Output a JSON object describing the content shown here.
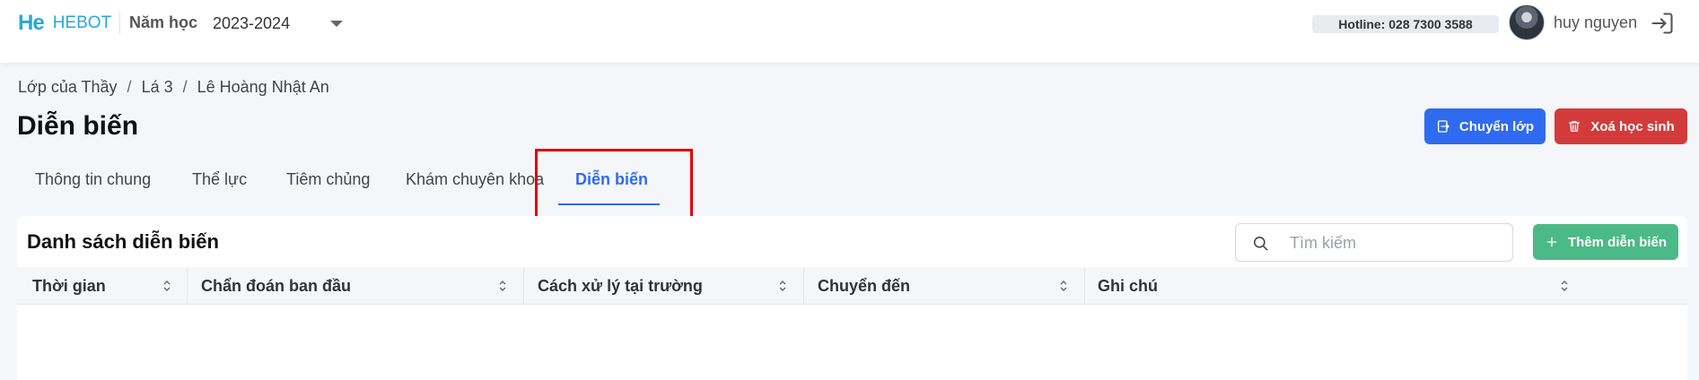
{
  "header": {
    "logo_mark": "He",
    "brand": "HEBOT",
    "year_label": "Năm học",
    "year_value": "2023-2024",
    "hotline": "Hotline: 028 7300 3588",
    "user_name": "huy nguyen"
  },
  "breadcrumb": {
    "items": [
      "Lớp của Thầy",
      "Lá 3",
      "Lê Hoàng Nhật An"
    ],
    "separator": "/"
  },
  "page": {
    "title": "Diễn biến",
    "move_button": "Chuyển lớp",
    "delete_button": "Xoá học sinh"
  },
  "tabs": [
    "Thông tin chung",
    "Thể lực",
    "Tiêm chủng",
    "Khám chuyên khoa",
    "Diễn biến"
  ],
  "active_tab": "Diễn biến",
  "list": {
    "title": "Danh sách diễn biến",
    "search_placeholder": "Tìm kiếm",
    "add_button": "Thêm diễn biến",
    "columns": [
      "Thời gian",
      "Chẩn đoán ban đầu",
      "Cách xử lý tại trường",
      "Chuyển đến",
      "Ghi chú"
    ],
    "rows": []
  },
  "colors": {
    "primary": "#2f6bf0",
    "danger": "#d33b3b",
    "success": "#4cba86",
    "brand": "#27a9d8",
    "highlight": "#e00000"
  },
  "icons": {
    "year_caret": "chevron-down-icon",
    "logout": "logout-icon",
    "move": "exit-to-icon",
    "delete": "trash-icon",
    "search": "search-icon",
    "add": "plus-icon",
    "sort": "sort-icon"
  }
}
